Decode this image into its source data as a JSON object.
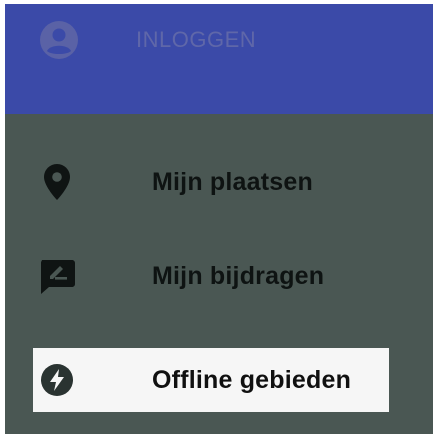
{
  "header": {
    "login_label": "INLOGGEN",
    "icon": "account-circle-icon",
    "color": "#3b4aa8"
  },
  "drawer": {
    "background": "#4a5753",
    "items": [
      {
        "label": "Mijn plaatsen",
        "icon": "place-pin-icon",
        "selected": false
      },
      {
        "label": "Mijn bijdragen",
        "icon": "rate-review-icon",
        "selected": false
      },
      {
        "label": "Offline gebieden",
        "icon": "offline-bolt-icon",
        "selected": true
      }
    ]
  }
}
